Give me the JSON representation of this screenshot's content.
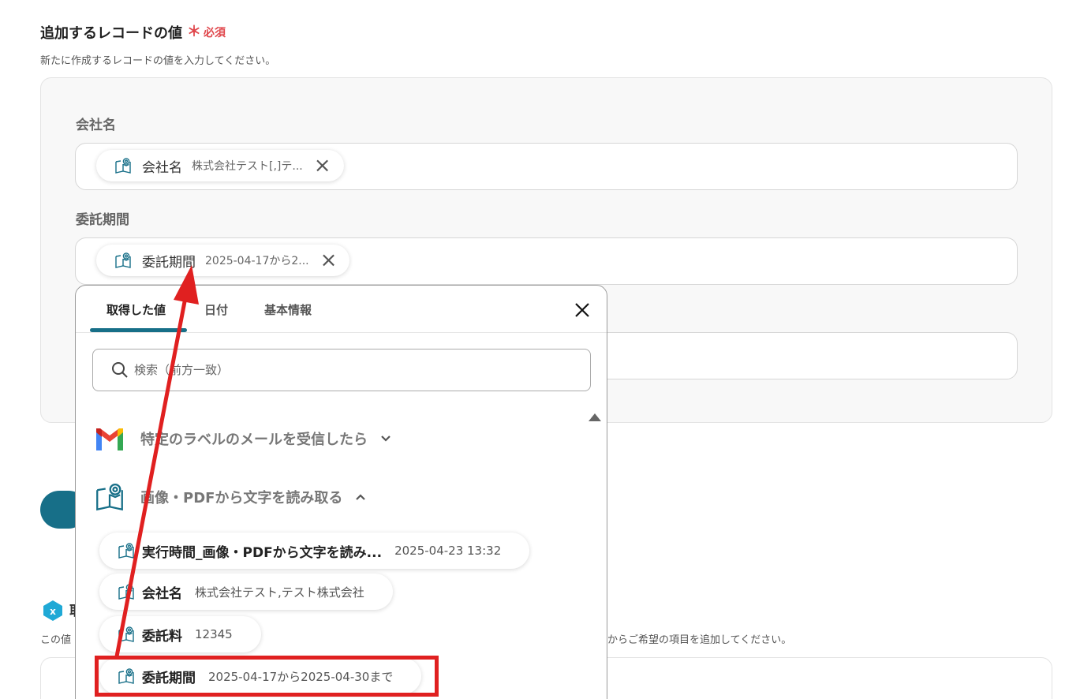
{
  "section": {
    "title": "追加するレコードの値",
    "required_mark": "＊",
    "required_label": "必須",
    "description": "新たに作成するレコードの値を入力してください。"
  },
  "fields": [
    {
      "label": "会社名",
      "chip_name": "会社名",
      "chip_value": "株式会社テスト[,]テ..."
    },
    {
      "label": "委託期間",
      "chip_name": "委託期間",
      "chip_value": "2025-04-17から2..."
    }
  ],
  "background": {
    "heading_fragment": "取",
    "left_text": "この値",
    "right_text": "からご希望の項目を追加してください。",
    "icon": "x-badge-icon"
  },
  "popup": {
    "tabs": [
      "取得した値",
      "日付",
      "基本情報"
    ],
    "active_tab": 0,
    "search_placeholder": "検索（前方一致）",
    "groups": [
      {
        "title": "特定のラベルのメールを受信したら",
        "icon": "gmail-icon",
        "expanded": false
      },
      {
        "title": "画像・PDFから文字を読み取る",
        "icon": "ocr-book-icon",
        "expanded": true
      }
    ],
    "options": [
      {
        "name": "実行時間_画像・PDFから文字を読み...",
        "value": "2025-04-23 13:32"
      },
      {
        "name": "会社名",
        "value": "株式会社テスト,テスト株式会社"
      },
      {
        "name": "委託料",
        "value": "12345"
      },
      {
        "name": "委託期間",
        "value": "2025-04-17から2025-04-30まで"
      }
    ]
  },
  "colors": {
    "accent": "#176f88",
    "required": "#e0474c",
    "annotation": "#e02020"
  }
}
